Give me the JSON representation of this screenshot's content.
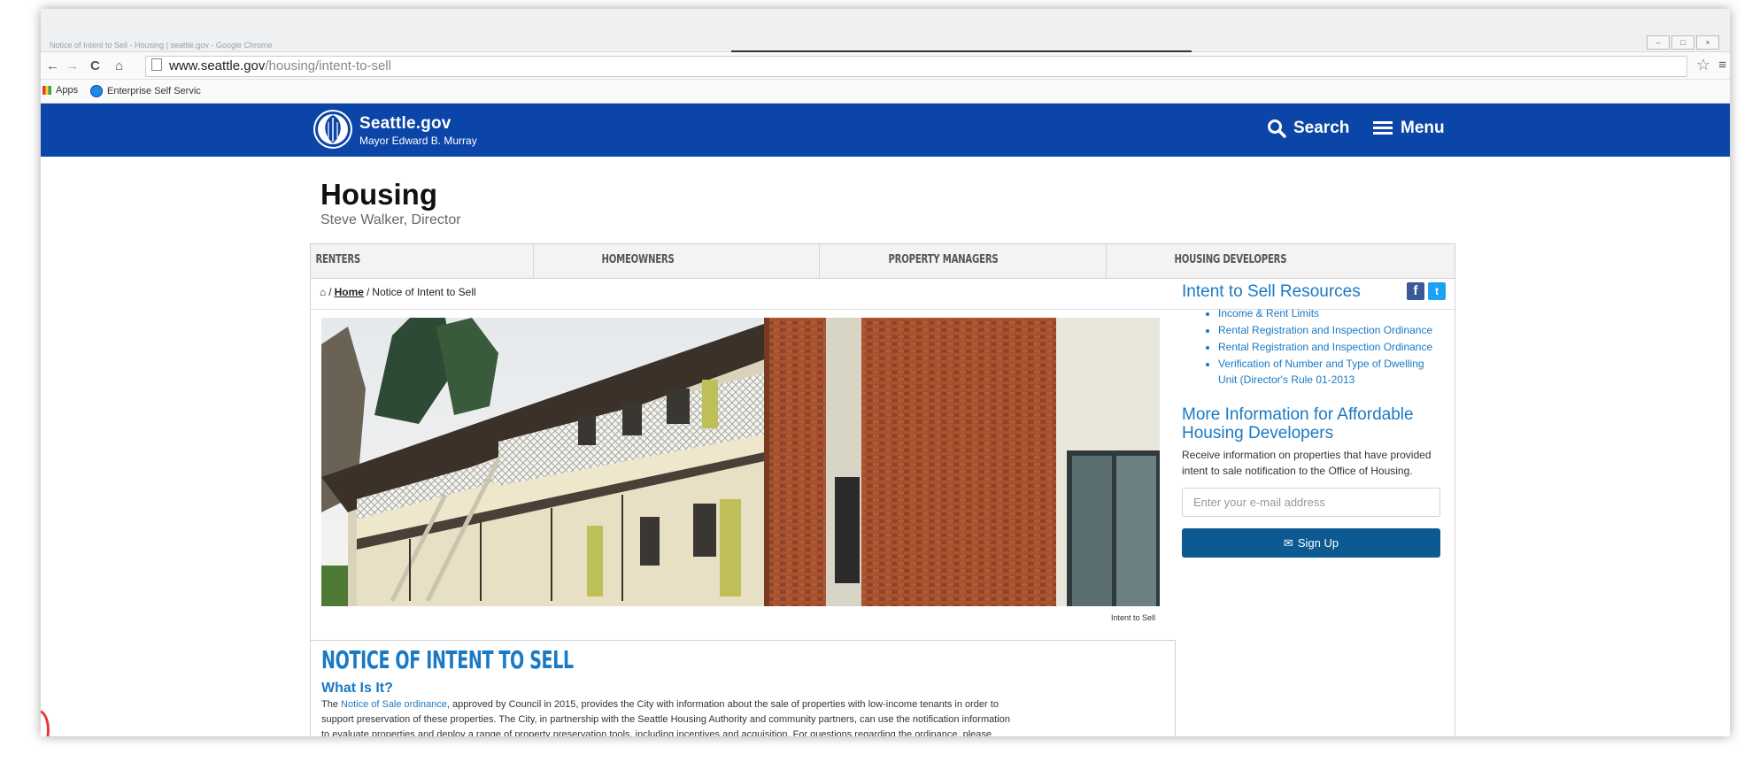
{
  "browser": {
    "window_title": "Notice of Intent to Sell - Housing | seattle.gov - Google Chrome",
    "window_controls": [
      "–",
      "□",
      "×"
    ],
    "url_host": "www.seattle.gov",
    "url_path": "/housing/intent-to-sell",
    "bookmarks": [
      {
        "label": "Apps",
        "icon": "apps-grid-icon"
      },
      {
        "label": "Enterprise Self Servic",
        "icon": "globe-icon"
      }
    ]
  },
  "header": {
    "brand": "Seattle.gov",
    "mayor": "Mayor Edward B. Murray",
    "search_label": "Search",
    "menu_label": "Menu"
  },
  "department": {
    "name": "Housing",
    "director": "Steve Walker, Director"
  },
  "nav": {
    "items": [
      "RENTERS",
      "HOMEOWNERS",
      "PROPERTY MANAGERS",
      "HOUSING DEVELOPERS"
    ]
  },
  "breadcrumb": {
    "home": "Home",
    "current": "Notice of Intent to Sell"
  },
  "hero": {
    "caption": "Intent to Sell"
  },
  "article": {
    "title": "NOTICE OF INTENT TO SELL",
    "subtitle": "What Is It?",
    "body_link": "Notice of Sale ordinance",
    "body_lines": [
      ", approved by Council in 2015, provides the City with information about the sale of properties with low-income tenants in order to",
      "support preservation of these properties. The City, in partnership with the Seattle Housing Authority and community partners, can use the notification information",
      "to evaluate properties and deploy a range of property preservation tools, including incentives and acquisition. For questions regarding the ordinance, please"
    ]
  },
  "sidebar": {
    "resources_heading": "Intent to Sell Resources",
    "resources": [
      "Income & Rent Limits",
      "Rental Registration and Inspection Ordinance",
      "Rental Registration and Inspection Ordinance",
      "Verification of Number and Type of Dwelling Unit (Director's Rule 01-2013"
    ],
    "more_heading": "More Information for Affordable Housing Developers",
    "more_text": "Receive information on properties that have provided intent to sale notification to the Office of Housing.",
    "email_placeholder": "Enter your e-mail address",
    "signup_label": "Sign Up"
  },
  "colors": {
    "header_blue": "#0c45a8",
    "link_blue": "#1a79c4",
    "button_blue": "#0d5a93"
  }
}
